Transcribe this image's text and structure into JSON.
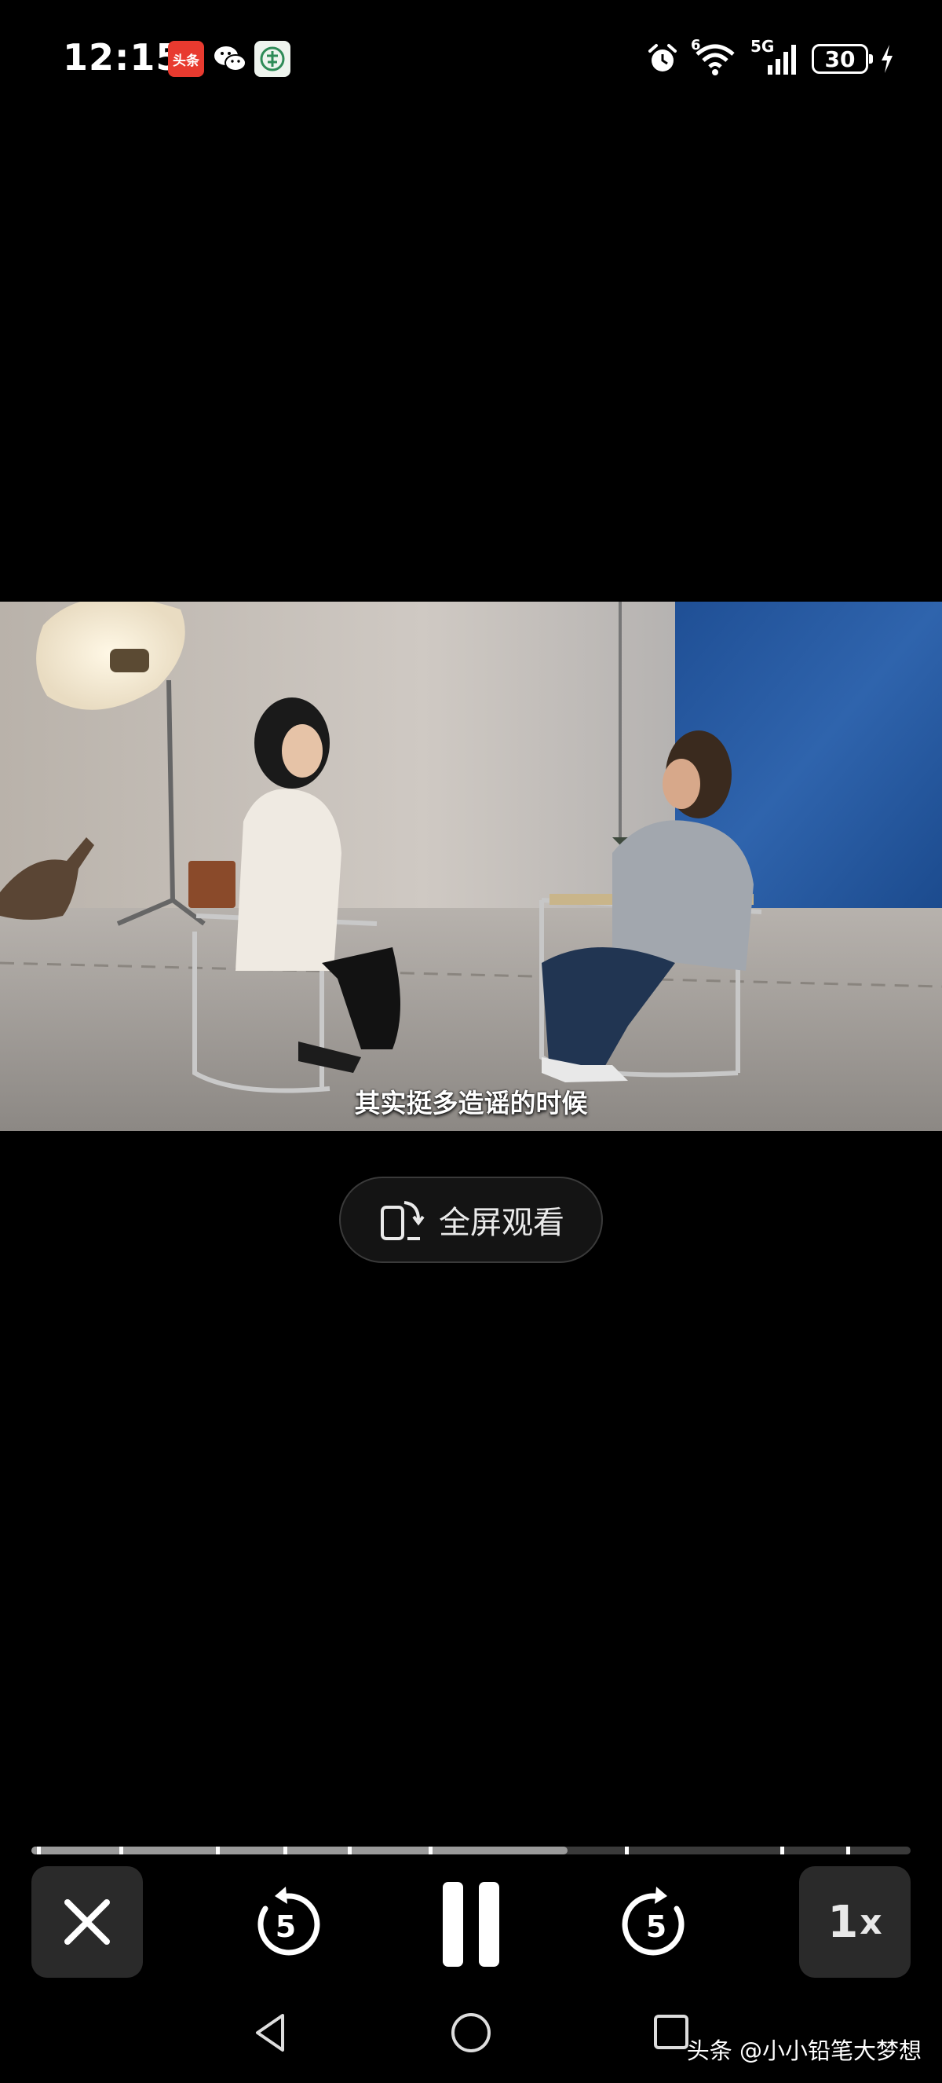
{
  "status_bar": {
    "time": "12:15",
    "app_badges": [
      "头条",
      "wechat-icon",
      "app-icon"
    ],
    "network": "5G",
    "wifi_level": "6",
    "battery": "30"
  },
  "video": {
    "subtitle": "其实挺多造谣的时候",
    "progress_fraction": 0.61,
    "buffer_marks": [
      0.006,
      0.1,
      0.21,
      0.287,
      0.36,
      0.452,
      0.675,
      0.852,
      0.927
    ]
  },
  "fullscreen_button": {
    "label": "全屏观看"
  },
  "controls": {
    "rewind_seconds": "5",
    "forward_seconds": "5",
    "speed_value": "1",
    "speed_suffix": "x"
  },
  "watermark": "头条 @小小铅笔大梦想",
  "colors": {
    "background": "#000000",
    "progress_fill": "#9a9a9a",
    "control_bg": "#2a2a2a"
  }
}
